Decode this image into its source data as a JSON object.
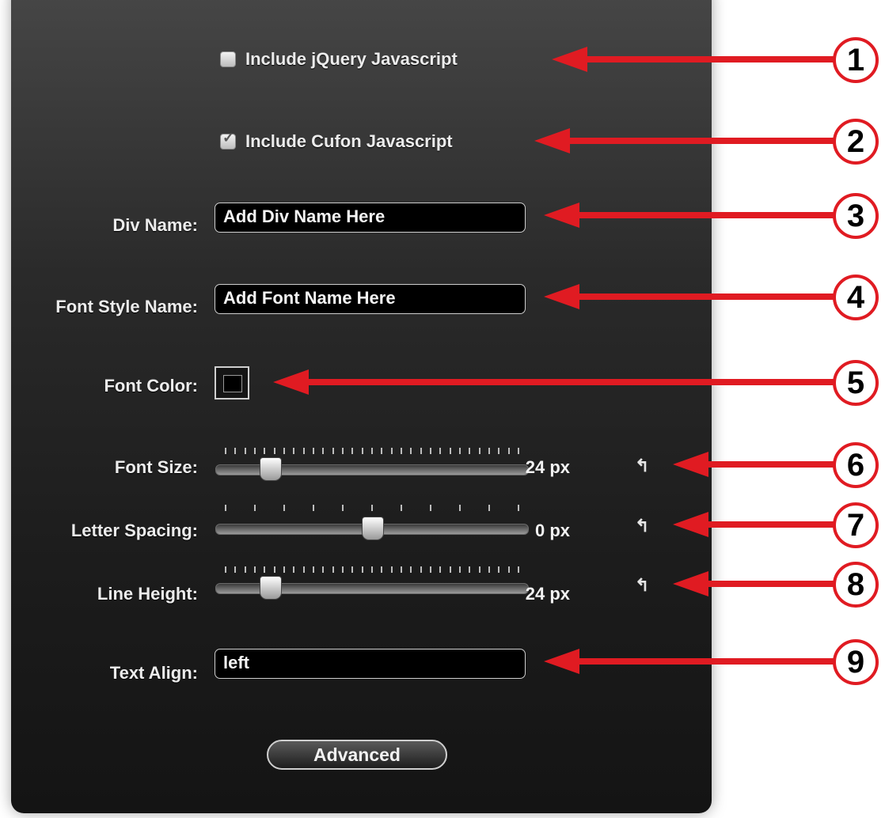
{
  "checkboxes": [
    {
      "label": "Include jQuery Javascript",
      "checked": false
    },
    {
      "label": "Include Cufon Javascript",
      "checked": true
    }
  ],
  "fields": {
    "div_name": {
      "label": "Div Name:",
      "value": "Add Div Name Here"
    },
    "font_style_name": {
      "label": "Font Style Name:",
      "value": "Add Font Name Here"
    },
    "font_color": {
      "label": "Font Color:",
      "value": "#000000"
    },
    "text_align": {
      "label": "Text Align:",
      "value": "left"
    }
  },
  "sliders": {
    "font_size": {
      "label": "Font Size:",
      "value_text": "24 px",
      "fraction": 0.15
    },
    "letter_spacing": {
      "label": "Letter Spacing:",
      "value_text": "0 px",
      "fraction": 0.5
    },
    "line_height": {
      "label": "Line Height:",
      "value_text": "24 px",
      "fraction": 0.15
    }
  },
  "reset_glyph": "↰",
  "advanced_button": "Advanced",
  "markers": [
    "1",
    "2",
    "3",
    "4",
    "5",
    "6",
    "7",
    "8",
    "9"
  ],
  "colors": {
    "accent_red": "#e01b22"
  }
}
